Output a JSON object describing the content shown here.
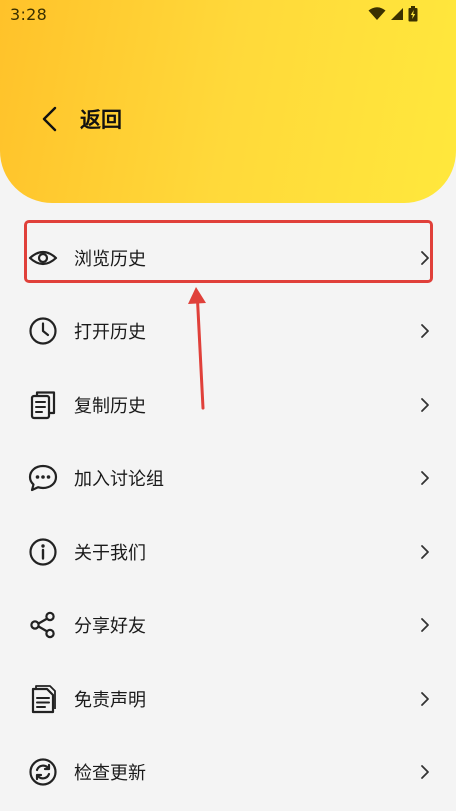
{
  "status_bar": {
    "time": "3:28",
    "icons": [
      "wifi-icon",
      "signal-icon",
      "battery-charging-icon"
    ]
  },
  "header": {
    "back_label": "返回",
    "back_icon": "chevron-left-icon",
    "gradient_colors": [
      "#ffc22a",
      "#ffe83c"
    ]
  },
  "menu": {
    "items": [
      {
        "label": "浏览历史",
        "icon": "eye-icon"
      },
      {
        "label": "打开历史",
        "icon": "clock-icon"
      },
      {
        "label": "复制历史",
        "icon": "copy-icon"
      },
      {
        "label": "加入讨论组",
        "icon": "chat-bubble-icon"
      },
      {
        "label": "关于我们",
        "icon": "info-icon"
      },
      {
        "label": "分享好友",
        "icon": "share-icon"
      },
      {
        "label": "免责声明",
        "icon": "document-icon"
      },
      {
        "label": "检查更新",
        "icon": "refresh-icon"
      }
    ]
  },
  "annotation": {
    "highlight_color": "#e0403a",
    "highlighted_item": "浏览历史"
  }
}
